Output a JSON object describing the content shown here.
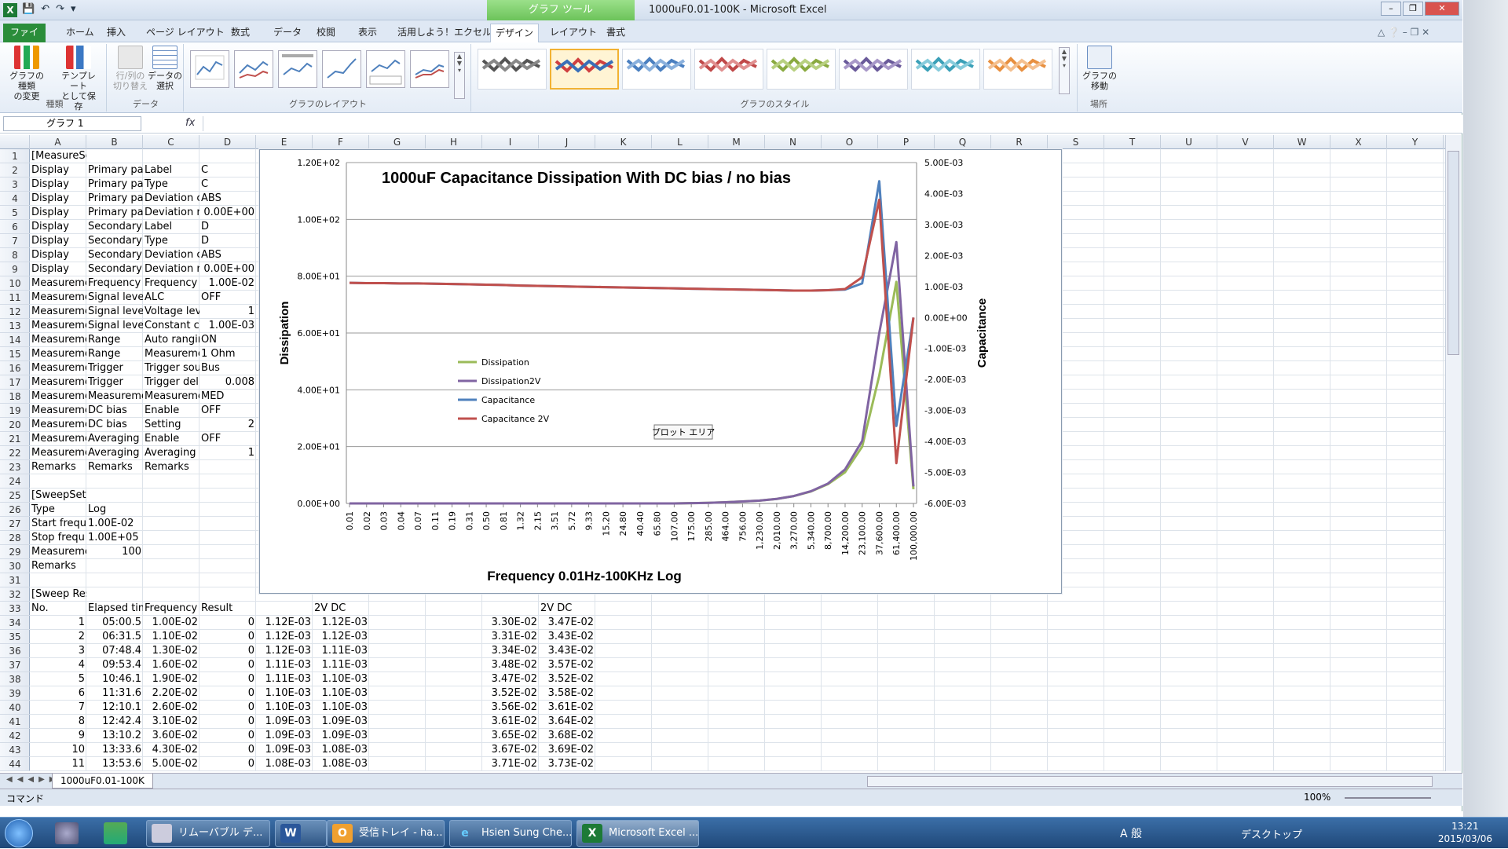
{
  "window": {
    "title": "1000uF0.01-100K - Microsoft Excel",
    "tool_tab": "グラフ ツール",
    "app_icon": "X"
  },
  "tabs": [
    "ファイル",
    "ホーム",
    "挿入",
    "ページ レイアウト",
    "数式",
    "データ",
    "校閲",
    "表示",
    "活用しよう！エクセル",
    "デザイン",
    "レイアウト",
    "書式"
  ],
  "ribbon": {
    "groups": {
      "type": "種類",
      "data": "データ",
      "layout": "グラフのレイアウト",
      "style": "グラフのスタイル",
      "location": "場所"
    },
    "buttons": {
      "change_type": [
        "グラフの種類",
        "の変更"
      ],
      "save_template": [
        "テンプレート",
        "として保存"
      ],
      "switch_rowcol": [
        "行/列の",
        "切り替え"
      ],
      "select_data": [
        "データの",
        "選択"
      ],
      "move_chart": [
        "グラフの",
        "移動"
      ]
    },
    "style_colors": [
      "#555555",
      "#d04040",
      "#4a7fc0",
      "#c04848",
      "#8aaa40",
      "#6a5a9a",
      "#3aa0b8",
      "#e89040"
    ]
  },
  "formula_bar": {
    "name_box": "グラフ 1",
    "fx": "fx",
    "value": ""
  },
  "columns": [
    "A",
    "B",
    "C",
    "D",
    "E",
    "F",
    "G",
    "H",
    "I",
    "J",
    "K",
    "L",
    "M",
    "N",
    "O",
    "P",
    "Q",
    "R",
    "S",
    "T",
    "U",
    "V",
    "W",
    "X",
    "Y"
  ],
  "rows": [
    "1",
    "2",
    "3",
    "4",
    "5",
    "6",
    "7",
    "8",
    "9",
    "10",
    "11",
    "12",
    "13",
    "14",
    "15",
    "16",
    "17",
    "18",
    "19",
    "20",
    "21",
    "22",
    "23",
    "24",
    "25",
    "26",
    "27",
    "28",
    "29",
    "30",
    "31",
    "32",
    "33",
    "34",
    "35",
    "36",
    "37",
    "38",
    "39",
    "40",
    "41",
    "42",
    "43",
    "44"
  ],
  "measure_rows": [
    [
      "[MeasureSetting]",
      "",
      "",
      ""
    ],
    [
      "Display",
      "Primary par",
      "Label",
      "C"
    ],
    [
      "Display",
      "Primary par",
      "Type",
      "C"
    ],
    [
      "Display",
      "Primary par",
      "Deviation c",
      "ABS"
    ],
    [
      "Display",
      "Primary par",
      "Deviation r",
      "0.00E+00"
    ],
    [
      "Display",
      "Secondary",
      "Label",
      "D"
    ],
    [
      "Display",
      "Secondary",
      "Type",
      "D"
    ],
    [
      "Display",
      "Secondary",
      "Deviation c",
      "ABS"
    ],
    [
      "Display",
      "Secondary",
      "Deviation r",
      "0.00E+00"
    ],
    [
      "Measureme",
      "Frequency",
      "Frequency",
      "1.00E-02"
    ],
    [
      "Measureme",
      "Signal leve",
      "ALC",
      "OFF"
    ],
    [
      "Measureme",
      "Signal leve",
      "Voltage lev",
      "1"
    ],
    [
      "Measureme",
      "Signal leve",
      "Constant c",
      "1.00E-03"
    ],
    [
      "Measureme",
      "Range",
      "Auto rangir",
      "ON"
    ],
    [
      "Measureme",
      "Range",
      "Measureme",
      "1  Ohm"
    ],
    [
      "Measureme",
      "Trigger",
      "Trigger sou",
      "Bus"
    ],
    [
      "Measureme",
      "Trigger",
      "Trigger del",
      "0.008"
    ],
    [
      "Measureme",
      "Measureme",
      "Measureme",
      "MED"
    ],
    [
      "Measureme",
      "DC bias",
      "Enable",
      "OFF"
    ],
    [
      "Measureme",
      "DC bias",
      "Setting",
      "2"
    ],
    [
      "Measureme",
      "Averaging",
      "Enable",
      "OFF"
    ],
    [
      "Measureme",
      "Averaging",
      "Averaging c",
      "1"
    ],
    [
      "Remarks",
      "Remarks",
      "Remarks",
      ""
    ]
  ],
  "sweep_setting": [
    [
      "[SweepSetting]",
      ""
    ],
    [
      "Type",
      "Log"
    ],
    [
      "Start frequ",
      "1.00E-02"
    ],
    [
      "Stop frequ",
      "1.00E+05"
    ],
    [
      "Measureme",
      "100"
    ],
    [
      "Remarks",
      ""
    ]
  ],
  "sweep_result": {
    "title": "[Sweep Result]",
    "headers": [
      "No.",
      "Elapsed tim",
      "Frequency",
      "Result",
      "",
      "2V DC",
      "",
      "",
      "",
      "2V DC"
    ],
    "rows": [
      [
        "1",
        "05:00.5",
        "1.00E-02",
        "0",
        "1.12E-03",
        "1.12E-03",
        "3.30E-02",
        "3.47E-02"
      ],
      [
        "2",
        "06:31.5",
        "1.10E-02",
        "0",
        "1.12E-03",
        "1.12E-03",
        "3.31E-02",
        "3.43E-02"
      ],
      [
        "3",
        "07:48.4",
        "1.30E-02",
        "0",
        "1.12E-03",
        "1.11E-03",
        "3.34E-02",
        "3.43E-02"
      ],
      [
        "4",
        "09:53.4",
        "1.60E-02",
        "0",
        "1.11E-03",
        "1.11E-03",
        "3.48E-02",
        "3.57E-02"
      ],
      [
        "5",
        "10:46.1",
        "1.90E-02",
        "0",
        "1.11E-03",
        "1.10E-03",
        "3.47E-02",
        "3.52E-02"
      ],
      [
        "6",
        "11:31.6",
        "2.20E-02",
        "0",
        "1.10E-03",
        "1.10E-03",
        "3.52E-02",
        "3.58E-02"
      ],
      [
        "7",
        "12:10.1",
        "2.60E-02",
        "0",
        "1.10E-03",
        "1.10E-03",
        "3.56E-02",
        "3.61E-02"
      ],
      [
        "8",
        "12:42.4",
        "3.10E-02",
        "0",
        "1.09E-03",
        "1.09E-03",
        "3.61E-02",
        "3.64E-02"
      ],
      [
        "9",
        "13:10.2",
        "3.60E-02",
        "0",
        "1.09E-03",
        "1.09E-03",
        "3.65E-02",
        "3.68E-02"
      ],
      [
        "10",
        "13:33.6",
        "4.30E-02",
        "0",
        "1.09E-03",
        "1.08E-03",
        "3.67E-02",
        "3.69E-02"
      ],
      [
        "11",
        "13:53.6",
        "5.00E-02",
        "0",
        "1.08E-03",
        "1.08E-03",
        "3.71E-02",
        "3.73E-02"
      ]
    ]
  },
  "chart_data": {
    "type": "line",
    "title": "1000uF Capacitance Dissipation With DC bias / no bias",
    "xlabel": "Frequency 0.01Hz-100KHz Log",
    "ylabel": "Dissipation",
    "y2label": "Capacitance",
    "ylim": [
      0,
      120
    ],
    "y2lim": [
      -0.006,
      0.005
    ],
    "yticks": [
      "0.00E+00",
      "2.00E+01",
      "4.00E+01",
      "6.00E+01",
      "8.00E+01",
      "1.00E+02",
      "1.20E+02"
    ],
    "y2ticks": [
      "-6.00E-03",
      "-5.00E-03",
      "-4.00E-03",
      "-3.00E-03",
      "-2.00E-03",
      "-1.00E-03",
      "0.00E+00",
      "1.00E-03",
      "2.00E-03",
      "3.00E-03",
      "4.00E-03",
      "5.00E-03"
    ],
    "categories": [
      "0.01",
      "0.02",
      "0.03",
      "0.04",
      "0.07",
      "0.11",
      "0.19",
      "0.31",
      "0.50",
      "0.81",
      "1.32",
      "2.15",
      "3.51",
      "5.72",
      "9.33",
      "15.20",
      "24.80",
      "40.40",
      "65.80",
      "107.00",
      "175.00",
      "285.00",
      "464.00",
      "756.00",
      "1,230.00",
      "2,010.00",
      "3,270.00",
      "5,340.00",
      "8,700.00",
      "14,200.00",
      "23,100.00",
      "37,600.00",
      "61,400.00",
      "100,000.00"
    ],
    "grid": true,
    "legend_position": "left-middle",
    "hover_label": "プロット エリア",
    "series": [
      {
        "name": "Dissipation",
        "color": "#9bbb59",
        "axis": "y",
        "values": [
          0,
          0,
          0,
          0,
          0,
          0,
          0,
          0,
          0,
          0,
          0,
          0,
          0,
          0,
          0,
          0,
          0,
          0,
          0,
          0,
          0.1,
          0.2,
          0.4,
          0.7,
          1.0,
          1.6,
          2.6,
          4.2,
          6.8,
          11,
          20,
          45,
          78,
          5
        ]
      },
      {
        "name": "Dissipation2V",
        "color": "#8064a2",
        "axis": "y",
        "values": [
          0,
          0,
          0,
          0,
          0,
          0,
          0,
          0,
          0,
          0,
          0,
          0,
          0,
          0,
          0,
          0,
          0,
          0,
          0,
          0,
          0.1,
          0.2,
          0.4,
          0.7,
          1.0,
          1.6,
          2.6,
          4.3,
          7.0,
          12,
          22,
          60,
          92,
          6
        ]
      },
      {
        "name": "Capacitance",
        "color": "#4f81bd",
        "axis": "y2",
        "values": [
          0.00112,
          0.00111,
          0.00111,
          0.0011,
          0.0011,
          0.00109,
          0.00108,
          0.00107,
          0.00106,
          0.00105,
          0.00103,
          0.00102,
          0.00101,
          0.001,
          0.00099,
          0.00098,
          0.00097,
          0.00096,
          0.00095,
          0.00094,
          0.00093,
          0.00092,
          0.00091,
          0.0009,
          0.00089,
          0.00088,
          0.00087,
          0.00087,
          0.00088,
          0.0009,
          0.0011,
          0.0044,
          -0.0035,
          0.0
        ]
      },
      {
        "name": "Capacitance 2V",
        "color": "#c0504d",
        "axis": "y2",
        "values": [
          0.00112,
          0.00111,
          0.00111,
          0.0011,
          0.0011,
          0.00109,
          0.00108,
          0.00107,
          0.00106,
          0.00105,
          0.00103,
          0.00102,
          0.00101,
          0.001,
          0.00099,
          0.00098,
          0.00097,
          0.00096,
          0.00095,
          0.00094,
          0.00093,
          0.00092,
          0.00091,
          0.0009,
          0.00089,
          0.00088,
          0.00087,
          0.00087,
          0.00088,
          0.00092,
          0.0013,
          0.0038,
          -0.0047,
          0.0
        ]
      }
    ]
  },
  "sheet_tab": "1000uF0.01-100K",
  "status": {
    "mode": "コマンド",
    "zoom": "100%"
  },
  "taskbar": {
    "items": [
      "リムーバブル デ...",
      "",
      "受信トレイ - ha...",
      "Hsien Sung Che...",
      "Microsoft Excel ..."
    ],
    "desktop": "デスクトップ",
    "ime": "A 般",
    "time": "13:21",
    "date": "2015/03/06"
  }
}
